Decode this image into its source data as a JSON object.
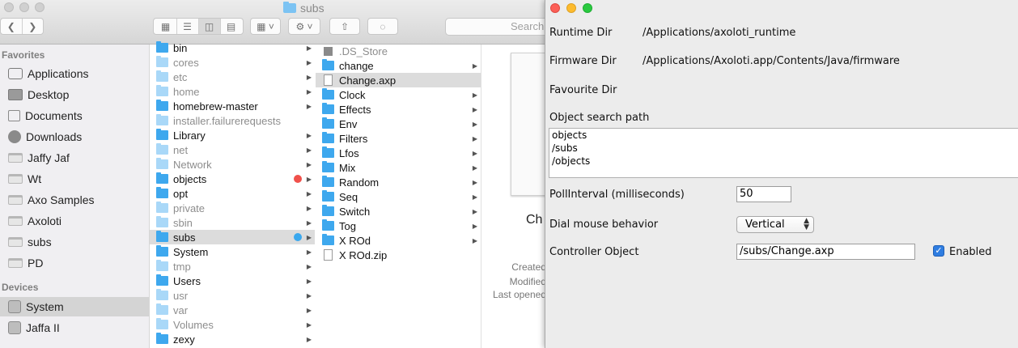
{
  "finder": {
    "title": "subs",
    "search_placeholder": "Search",
    "sidebar": {
      "favorites_header": "Favorites",
      "favorites": [
        {
          "label": "Applications",
          "icon": "applications-icon"
        },
        {
          "label": "Desktop",
          "icon": "desktop-icon"
        },
        {
          "label": "Documents",
          "icon": "documents-icon"
        },
        {
          "label": "Downloads",
          "icon": "downloads-icon"
        },
        {
          "label": "Jaffy Jaf",
          "icon": "folder-icon"
        },
        {
          "label": "Wt",
          "icon": "folder-icon"
        },
        {
          "label": "Axo Samples",
          "icon": "folder-icon"
        },
        {
          "label": "Axoloti",
          "icon": "folder-icon"
        },
        {
          "label": "subs",
          "icon": "folder-icon"
        },
        {
          "label": "PD",
          "icon": "folder-icon"
        }
      ],
      "devices_header": "Devices",
      "devices": [
        {
          "label": "System",
          "icon": "disk-icon",
          "selected": true
        },
        {
          "label": "Jaffa II",
          "icon": "disk-icon"
        }
      ]
    },
    "column1": [
      {
        "label": "bin",
        "dim": false
      },
      {
        "label": "cores",
        "dim": true
      },
      {
        "label": "etc",
        "dim": true
      },
      {
        "label": "home",
        "dim": true
      },
      {
        "label": "homebrew-master",
        "dim": false
      },
      {
        "label": "installer.failurerequests",
        "dim": true
      },
      {
        "label": "Library",
        "dim": false
      },
      {
        "label": "net",
        "dim": true
      },
      {
        "label": "Network",
        "dim": true
      },
      {
        "label": "objects",
        "dim": false,
        "tag": "#f0514b"
      },
      {
        "label": "opt",
        "dim": false
      },
      {
        "label": "private",
        "dim": true
      },
      {
        "label": "sbin",
        "dim": true
      },
      {
        "label": "subs",
        "dim": false,
        "tag": "#3aa8ee",
        "selected": true
      },
      {
        "label": "System",
        "dim": false
      },
      {
        "label": "tmp",
        "dim": true
      },
      {
        "label": "Users",
        "dim": false
      },
      {
        "label": "usr",
        "dim": true
      },
      {
        "label": "var",
        "dim": true
      },
      {
        "label": "Volumes",
        "dim": true
      },
      {
        "label": "zexy",
        "dim": false
      }
    ],
    "column2": [
      {
        "label": ".DS_Store",
        "dim": true,
        "kind": "file"
      },
      {
        "label": "change",
        "dim": false,
        "kind": "folder"
      },
      {
        "label": "Change.axp",
        "dim": false,
        "kind": "file",
        "selected": true
      },
      {
        "label": "Clock",
        "dim": false,
        "kind": "folder"
      },
      {
        "label": "Effects",
        "dim": false,
        "kind": "folder"
      },
      {
        "label": "Env",
        "dim": false,
        "kind": "folder"
      },
      {
        "label": "Filters",
        "dim": false,
        "kind": "folder"
      },
      {
        "label": "Lfos",
        "dim": false,
        "kind": "folder"
      },
      {
        "label": "Mix",
        "dim": false,
        "kind": "folder"
      },
      {
        "label": "Random",
        "dim": false,
        "kind": "folder"
      },
      {
        "label": "Seq",
        "dim": false,
        "kind": "folder"
      },
      {
        "label": "Switch",
        "dim": false,
        "kind": "folder"
      },
      {
        "label": "Tog",
        "dim": false,
        "kind": "folder"
      },
      {
        "label": "X ROd",
        "dim": false,
        "kind": "folder"
      },
      {
        "label": "X ROd.zip",
        "dim": false,
        "kind": "file"
      }
    ],
    "preview": {
      "name": "Ch",
      "created": "Created",
      "modified": "Modified",
      "last_opened": "Last opened"
    }
  },
  "prefs": {
    "runtime_dir_label": "Runtime Dir",
    "runtime_dir_value": "/Applications/axoloti_runtime",
    "firmware_dir_label": "Firmware Dir",
    "firmware_dir_value": "/Applications/Axoloti.app/Contents/Java/firmware",
    "favourite_dir_label": "Favourite Dir",
    "object_search_path_label": "Object search path",
    "object_search_path_lines": [
      "objects",
      "/subs",
      "/objects"
    ],
    "poll_interval_label": "PollInterval (milliseconds)",
    "poll_interval_value": "50",
    "dial_mouse_label": "Dial mouse behavior",
    "dial_mouse_value": "Vertical",
    "controller_object_label": "Controller Object",
    "controller_object_value": "/subs/Change.axp",
    "enabled_label": "Enabled",
    "enabled_checked": true
  }
}
